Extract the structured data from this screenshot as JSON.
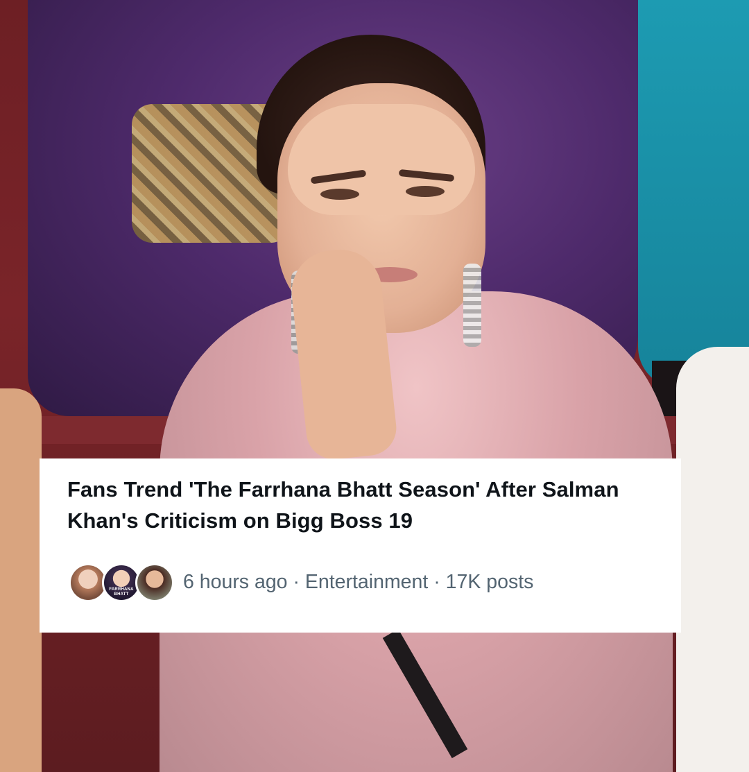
{
  "trend_card": {
    "headline": "Fans Trend 'The Farrhana Bhatt Season' After Salman Khan's Criticism on Bigg Boss 19",
    "avatars": [
      {
        "icon": "avatar-1"
      },
      {
        "icon": "avatar-2",
        "text": "FARRHANA BHATT"
      },
      {
        "icon": "avatar-3"
      }
    ],
    "time": "6 hours ago",
    "separator": "·",
    "category": "Entertainment",
    "posts": "17K posts"
  },
  "colors": {
    "card_background": "#ffffff",
    "headline": "#0f1419",
    "meta_text": "#536471"
  }
}
